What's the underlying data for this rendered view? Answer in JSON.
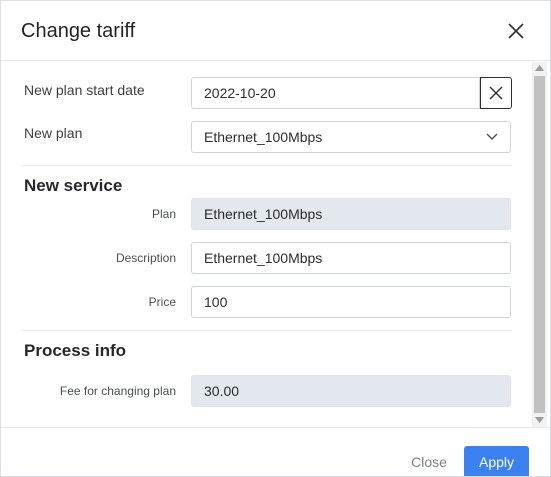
{
  "dialog": {
    "title": "Change tariff"
  },
  "fields": {
    "start_date": {
      "label": "New plan start date",
      "value": "2022-10-20"
    },
    "new_plan": {
      "label": "New plan",
      "value": "Ethernet_100Mbps"
    }
  },
  "new_service": {
    "title": "New service",
    "plan": {
      "label": "Plan",
      "value": "Ethernet_100Mbps"
    },
    "description": {
      "label": "Description",
      "value": "Ethernet_100Mbps"
    },
    "price": {
      "label": "Price",
      "value": "100"
    }
  },
  "process_info": {
    "title": "Process info",
    "fee": {
      "label": "Fee for changing plan",
      "value": "30.00"
    }
  },
  "footer": {
    "close_label": "Close",
    "apply_label": "Apply"
  },
  "icons": {
    "close": "close-icon",
    "clear": "clear-icon",
    "dropdown": "chevron-down-icon"
  },
  "colors": {
    "primary": "#3b82f0",
    "readonly_bg": "#e3e7ee"
  }
}
